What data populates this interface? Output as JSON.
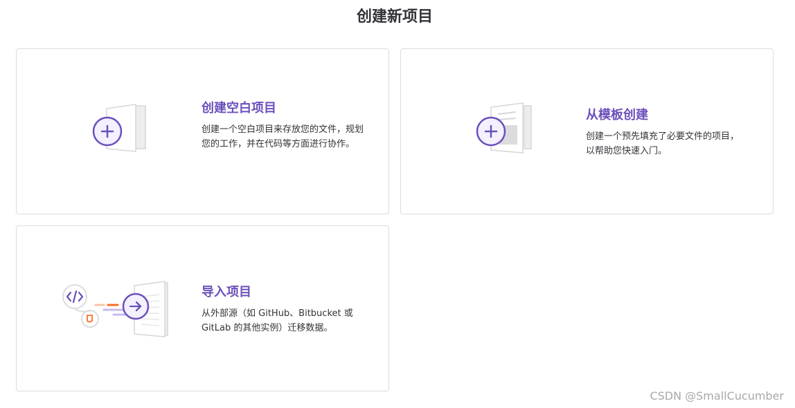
{
  "header": {
    "title": "创建新项目"
  },
  "cards": {
    "blank": {
      "title": "创建空白项目",
      "description": "创建一个空白项目来存放您的文件，规划您的工作，并在代码等方面进行协作。",
      "icon": "plus-document-icon"
    },
    "template": {
      "title": "从模板创建",
      "description": "创建一个预先填充了必要文件的项目，以帮助您快速入门。",
      "icon": "template-document-icon"
    },
    "import": {
      "title": "导入项目",
      "description": "从外部源（如 GitHub、Bitbucket 或 GitLab 的其他实例）迁移数据。",
      "icon": "import-arrow-icon"
    }
  },
  "watermark": {
    "text": "CSDN @SmallCucumber"
  },
  "colors": {
    "accent": "#6b4fbb",
    "accent_light": "#f4f0ff",
    "border": "#dcdcde",
    "orange": "#fc6d26"
  }
}
